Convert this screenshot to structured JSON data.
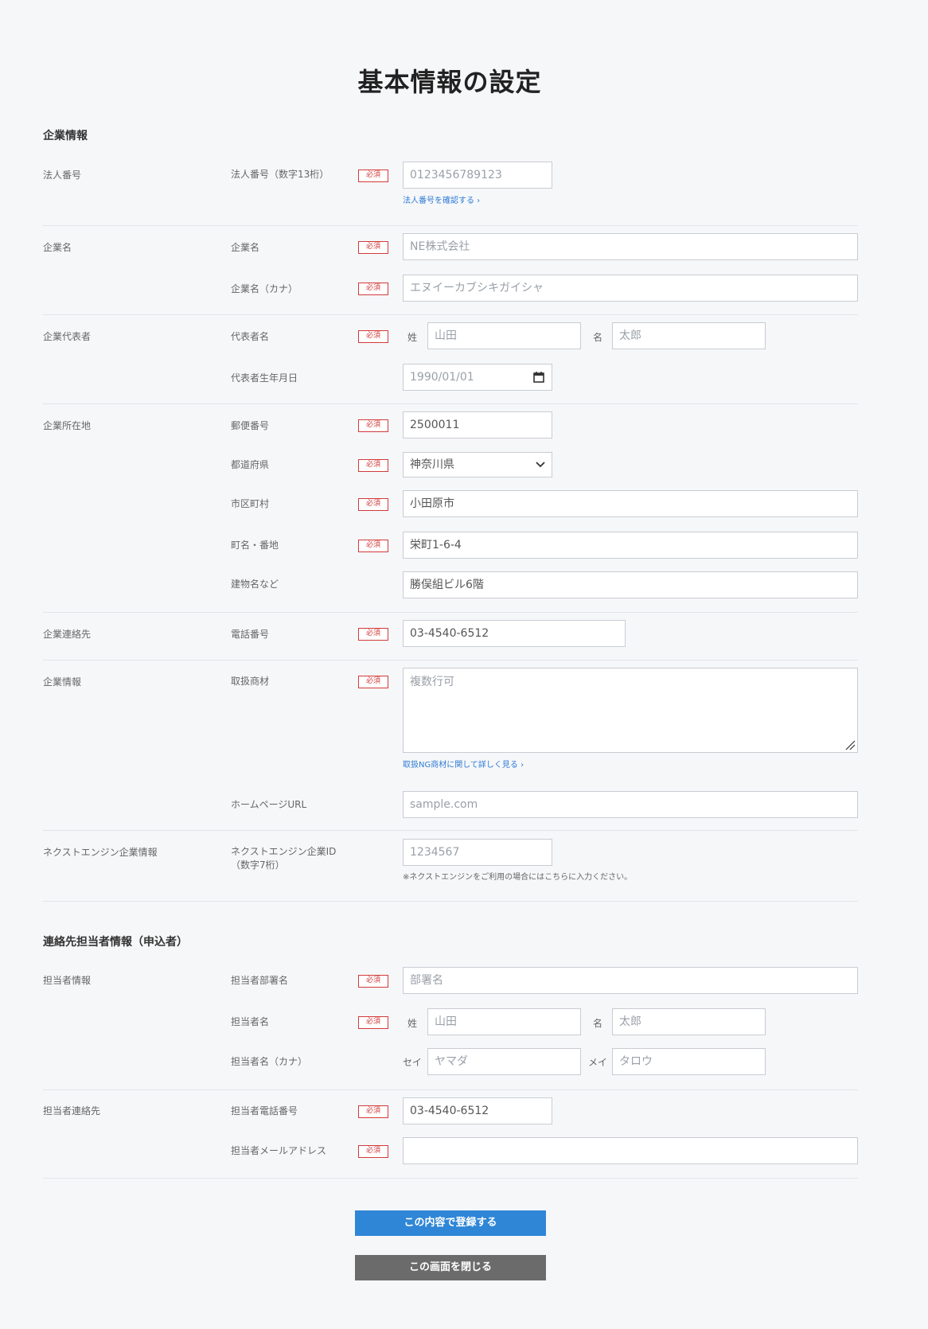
{
  "page_title": "基本情報の設定",
  "required_label": "必須",
  "sections": {
    "company": "企業情報",
    "contact": "連絡先担当者情報（申込者）"
  },
  "groups": {
    "corp_number": "法人番号",
    "company_name": "企業名",
    "representative": "企業代表者",
    "address": "企業所在地",
    "company_contact": "企業連絡先",
    "company_info": "企業情報",
    "ne_info": "ネクストエンジン企業情報",
    "person_info": "担当者情報",
    "person_contact": "担当者連絡先"
  },
  "fields": {
    "corp_number": {
      "label": "法人番号（数字13桁）",
      "value": "0123456789123",
      "help": "法人番号を確認する ›"
    },
    "company_name": {
      "label": "企業名",
      "value": "NE株式会社"
    },
    "company_kana": {
      "label": "企業名（カナ）",
      "value": "エヌイーカブシキガイシャ"
    },
    "rep_name": {
      "label": "代表者名",
      "sei_prefix": "姓",
      "sei": "山田",
      "mei_prefix": "名",
      "mei": "太郎"
    },
    "rep_birth": {
      "label": "代表者生年月日",
      "value": "1990/01/01"
    },
    "zip": {
      "label": "郵便番号",
      "value": "2500011"
    },
    "prefecture": {
      "label": "都道府県",
      "value": "神奈川県"
    },
    "city": {
      "label": "市区町村",
      "value": "小田原市"
    },
    "street": {
      "label": "町名・番地",
      "value": "栄町1-6-4"
    },
    "building": {
      "label": "建物名など",
      "value": "勝俣組ビル6階"
    },
    "phone": {
      "label": "電話番号",
      "value": "03-4540-6512"
    },
    "products": {
      "label": "取扱商材",
      "placeholder": "複数行可",
      "help": "取扱NG商材に関して詳しく見る ›"
    },
    "homepage": {
      "label": "ホームページURL",
      "placeholder": "sample.com"
    },
    "ne_id": {
      "label": "ネクストエンジン企業ID\n（数字7桁）",
      "placeholder": "1234567",
      "note": "※ネクストエンジンをご利用の場合にはこちらに入力ください。"
    },
    "dept": {
      "label": "担当者部署名",
      "placeholder": "部署名"
    },
    "person_name": {
      "label": "担当者名",
      "sei_prefix": "姓",
      "sei": "山田",
      "mei_prefix": "名",
      "mei": "太郎"
    },
    "person_kana": {
      "label": "担当者名（カナ）",
      "sei_prefix": "セイ",
      "sei": "ヤマダ",
      "mei_prefix": "メイ",
      "mei": "タロウ"
    },
    "person_phone": {
      "label": "担当者電話番号",
      "value": "03-4540-6512"
    },
    "person_email": {
      "label": "担当者メールアドレス",
      "value": ""
    }
  },
  "buttons": {
    "submit": "この内容で登録する",
    "close": "この画面を閉じる"
  },
  "icons": {
    "calendar": "calendar-icon",
    "dropdown": "chevron-down-icon",
    "resize": "resize-handle-icon"
  }
}
